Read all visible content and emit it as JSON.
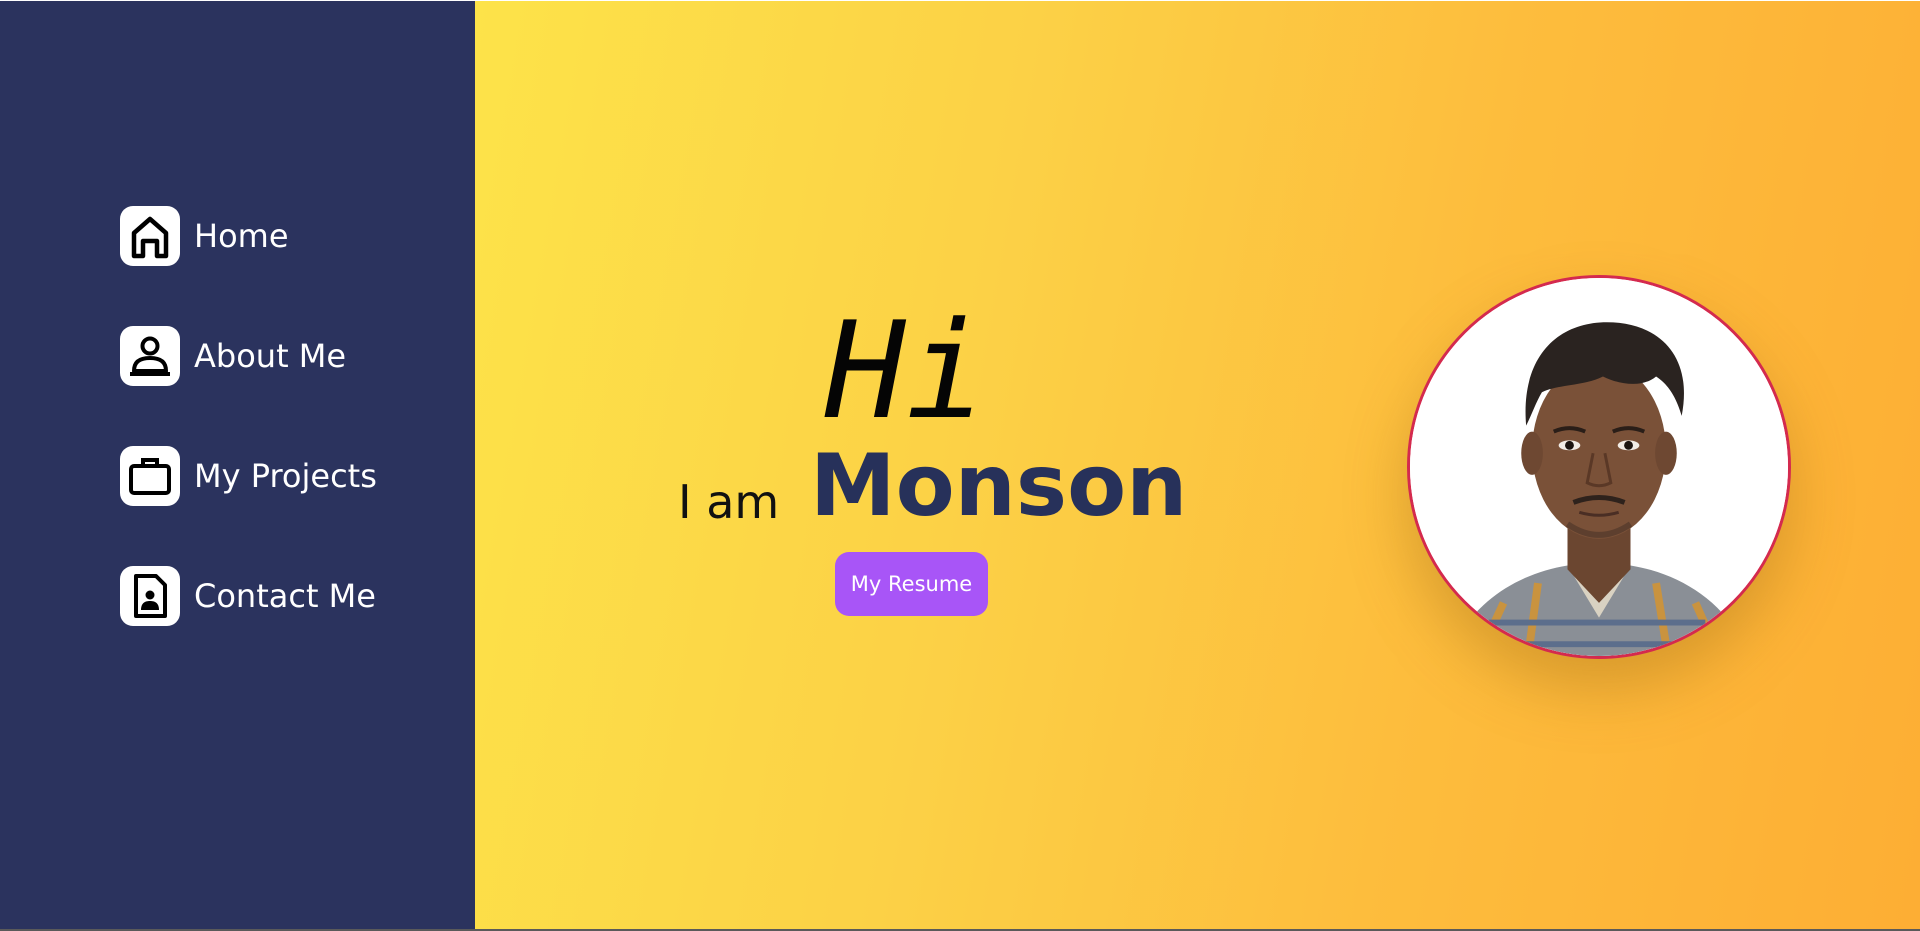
{
  "sidebar": {
    "items": [
      {
        "label": "Home",
        "icon": "home-icon"
      },
      {
        "label": "About Me",
        "icon": "user-icon"
      },
      {
        "label": "My Projects",
        "icon": "briefcase-icon"
      },
      {
        "label": "Contact Me",
        "icon": "contact-card-icon"
      }
    ]
  },
  "hero": {
    "greeting": "Hi",
    "intro": "I am",
    "name": "Monson",
    "resume_button": "My Resume"
  },
  "profile": {
    "photo": "profile-photo"
  },
  "colors": {
    "sidebar_bg": "#2b335e",
    "gradient_start": "#fde349",
    "gradient_end": "#fdae34",
    "name_text": "#27315a",
    "button_bg": "#a855f7",
    "avatar_border": "#d42a4e"
  }
}
